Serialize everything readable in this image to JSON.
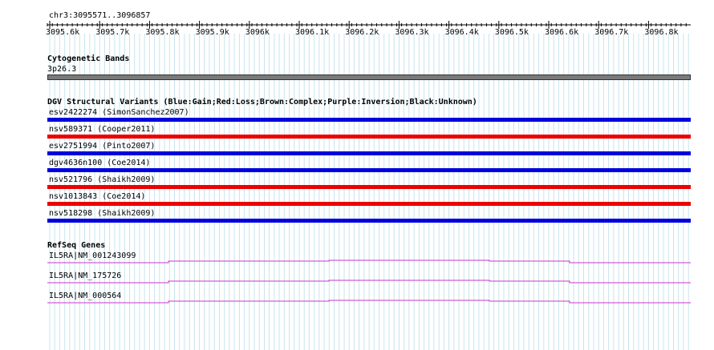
{
  "ruler": {
    "title": "chr3:3095571..3096857",
    "ticks": [
      "3095.6k",
      "3095.7k",
      "3095.8k",
      "3095.9k",
      "3096k",
      "3096.1k",
      "3096.2k",
      "3096.3k",
      "3096.4k",
      "3096.5k",
      "3096.6k",
      "3096.7k",
      "3096.8k"
    ]
  },
  "cytobands": {
    "title": "Cytogenetic Bands",
    "band_label": "3p26.3",
    "band_color": "#7a7a7a"
  },
  "dgv": {
    "title": "DGV Structural Variants (Blue:Gain;Red:Loss;Brown:Complex;Purple:Inversion;Black:Unknown)",
    "colors": {
      "gain": "#0000dd",
      "loss": "#ee0000"
    },
    "variants": [
      {
        "label": "esv2422274 (SimonSanchez2007)",
        "type": "gain"
      },
      {
        "label": "nsv589371 (Cooper2011)",
        "type": "loss"
      },
      {
        "label": "esv2751994 (Pinto2007)",
        "type": "gain"
      },
      {
        "label": "dgv4636n100 (Coe2014)",
        "type": "gain"
      },
      {
        "label": "nsv521796 (Shaikh2009)",
        "type": "loss"
      },
      {
        "label": "nsv1013843 (Coe2014)",
        "type": "loss"
      },
      {
        "label": "nsv518298 (Shaikh2009)",
        "type": "gain"
      }
    ]
  },
  "refseq": {
    "title": "RefSeq Genes",
    "color": "#cc33cc",
    "genes": [
      {
        "label": "IL5RA|NM_001243099"
      },
      {
        "label": "IL5RA|NM_175726"
      },
      {
        "label": "IL5RA|NM_000564"
      }
    ]
  }
}
